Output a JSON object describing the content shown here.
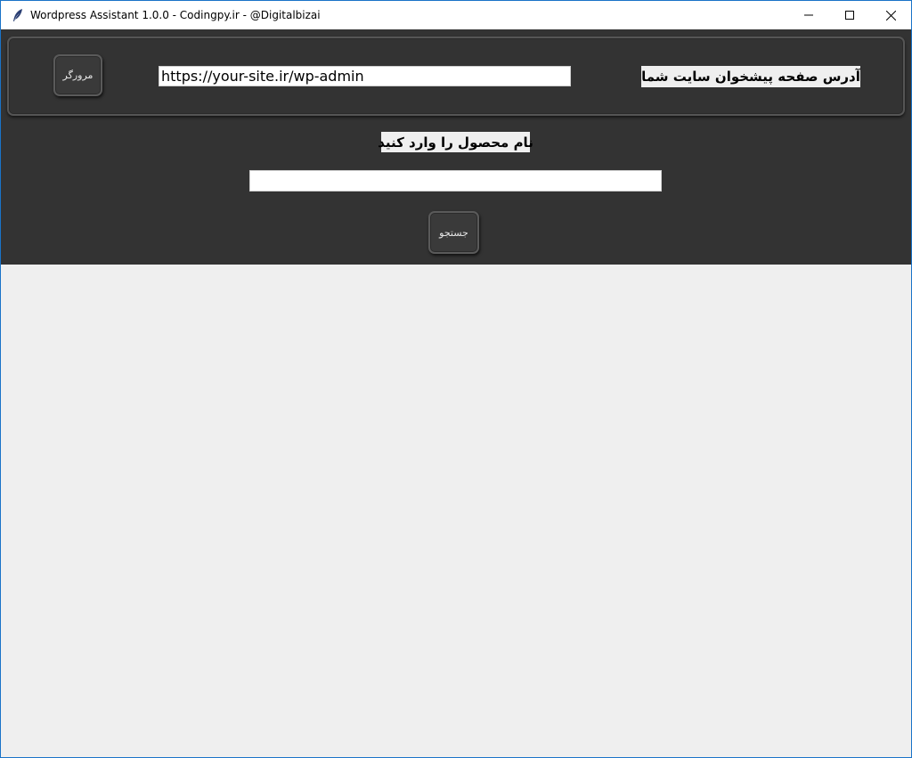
{
  "window": {
    "title": "Wordpress Assistant 1.0.0 - Codingpy.ir - @Digitalbizai",
    "icon": "feather-icon",
    "controls": [
      "minimize-icon",
      "maximize-icon",
      "close-icon"
    ]
  },
  "header_frame": {
    "browse_button_label": "مرورگر",
    "url_input_value": "https://your-site.ir/wp-admin",
    "url_label": "آدرس صفحه پیشخوان سایت شما"
  },
  "product": {
    "label": "نام محصول را وارد کنید",
    "input_value": "",
    "search_button_label": "جستجو"
  },
  "colors": {
    "dark_panel": "#333333",
    "body": "#efefef",
    "window_border": "#1a73c8"
  }
}
